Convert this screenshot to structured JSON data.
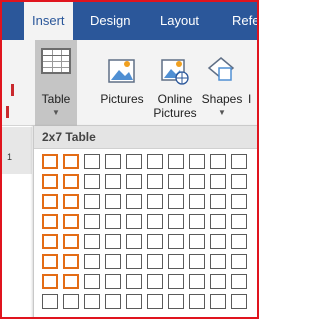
{
  "tabs": [
    {
      "label": "Insert",
      "active": true
    },
    {
      "label": "Design",
      "active": false
    },
    {
      "label": "Layout",
      "active": false
    },
    {
      "label": "Refe",
      "active": false
    }
  ],
  "ribbon": {
    "table": {
      "label": "Table",
      "icon": "table-icon"
    },
    "pictures": {
      "label": "Pictures",
      "icon": "pictures-icon"
    },
    "online_pictures": {
      "label_line1": "Online",
      "label_line2": "Pictures",
      "icon": "online-pictures-icon"
    },
    "shapes": {
      "label": "Shapes",
      "icon": "shapes-icon"
    },
    "partial": "I"
  },
  "ruler_number": "1",
  "dropdown": {
    "header": "2x7 Table",
    "grid_columns": 10,
    "grid_rows": 8,
    "selected_columns": 2,
    "selected_rows": 7
  },
  "colors": {
    "accent": "#2b579a",
    "selection": "#e36c16",
    "frame": "#e0141e"
  }
}
